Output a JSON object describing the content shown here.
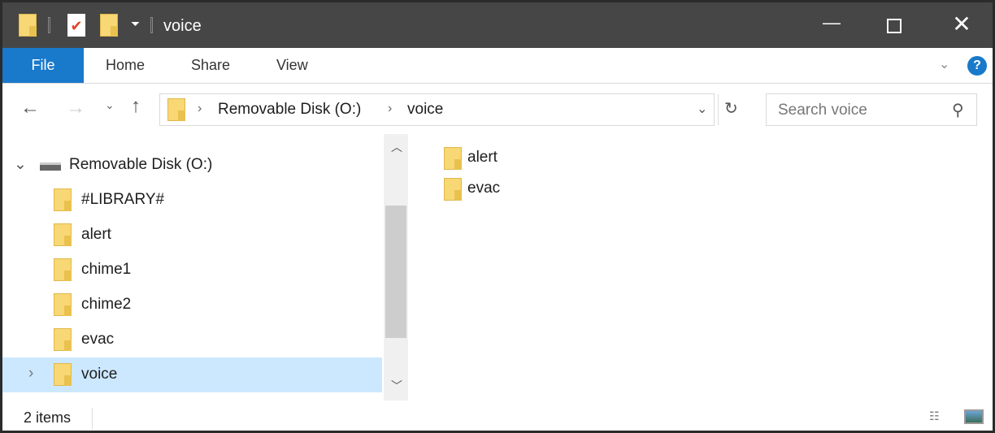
{
  "window": {
    "title": "voice"
  },
  "ribbon": {
    "tabs": [
      "File",
      "Home",
      "Share",
      "View"
    ]
  },
  "address": {
    "breadcrumb": [
      "Removable Disk (O:)",
      "voice"
    ]
  },
  "search": {
    "placeholder": "Search voice"
  },
  "nav": {
    "root": "Removable Disk (O:)",
    "items": [
      "#LIBRARY#",
      "alert",
      "chime1",
      "chime2",
      "evac",
      "voice"
    ],
    "selected": "voice"
  },
  "content": {
    "items": [
      "alert",
      "evac"
    ]
  },
  "status": {
    "count": "2 items"
  },
  "colors": {
    "accent": "#1979ca",
    "title_bar": "#464646",
    "selection": "#cce8ff",
    "folder": "#f8d775"
  }
}
